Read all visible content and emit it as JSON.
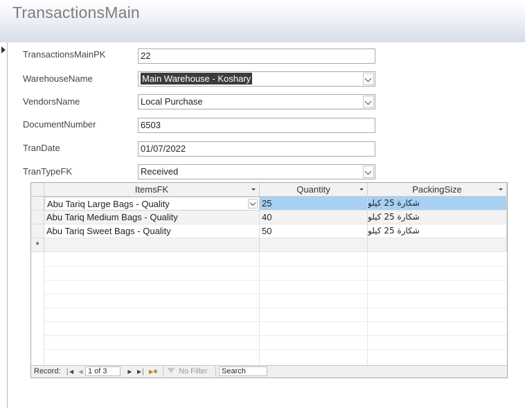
{
  "form": {
    "title": "TransactionsMain"
  },
  "fields": {
    "pk": {
      "label": "TransactionsMainPK",
      "value": "22"
    },
    "warehouse": {
      "label": "WarehouseName",
      "value": "Main Warehouse - Koshary"
    },
    "vendor": {
      "label": "VendorsName",
      "value": "Local Purchase"
    },
    "docnum": {
      "label": "DocumentNumber",
      "value": "6503"
    },
    "trandate": {
      "label": "TranDate",
      "value": "01/07/2022"
    },
    "trantype": {
      "label": "TranTypeFK",
      "value": "Received"
    }
  },
  "subform": {
    "columns": [
      "ItemsFK",
      "Quantity",
      "PackingSize"
    ],
    "rows": [
      {
        "item": "Abu Tariq Large Bags - Quality",
        "qty": "25",
        "packing": "شكارة 25 كيلو"
      },
      {
        "item": "Abu Tariq Medium Bags - Quality",
        "qty": "40",
        "packing": "شكارة 25 كيلو"
      },
      {
        "item": "Abu Tariq Sweet Bags - Quality",
        "qty": "50",
        "packing": "شكارة 25 كيلو"
      }
    ],
    "new_row_marker": "*"
  },
  "nav": {
    "record_label": "Record:",
    "current": "1 of 3",
    "filter_label": "No Filter",
    "search_placeholder": "Search",
    "first_icon": "first-record-icon",
    "prev_icon": "previous-record-icon",
    "next_icon": "next-record-icon",
    "last_icon": "last-record-icon",
    "new_icon": "new-record-icon"
  },
  "colors": {
    "title": "#7d7d7d",
    "selection": "#3c3c3c",
    "current_row": "#a8d0f2"
  }
}
